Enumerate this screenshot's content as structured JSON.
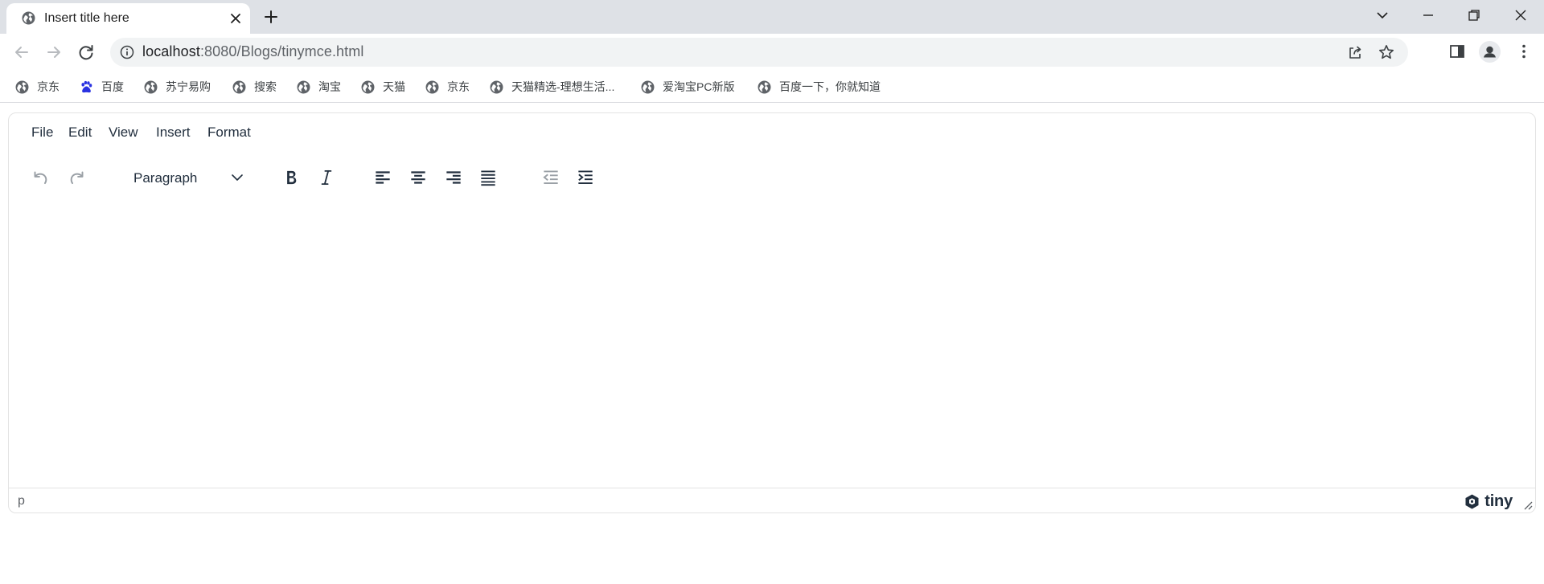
{
  "browser": {
    "tab_title": "Insert title here",
    "url_host": "localhost",
    "url_path": ":8080/Blogs/tinymce.html"
  },
  "bookmarks": [
    {
      "label": "京东",
      "icon": "globe-icon"
    },
    {
      "label": "百度",
      "icon": "baidu-paw-icon"
    },
    {
      "label": "苏宁易购",
      "icon": "globe-icon"
    },
    {
      "label": "搜索",
      "icon": "globe-icon"
    },
    {
      "label": "淘宝",
      "icon": "globe-icon"
    },
    {
      "label": "天猫",
      "icon": "globe-icon"
    },
    {
      "label": "京东",
      "icon": "globe-icon"
    },
    {
      "label": "天猫精选-理想生活...",
      "icon": "globe-icon"
    },
    {
      "label": "爱淘宝PC新版",
      "icon": "globe-icon"
    },
    {
      "label": "百度一下，你就知道",
      "icon": "globe-icon"
    }
  ],
  "editor": {
    "menu": [
      "File",
      "Edit",
      "View",
      "Insert",
      "Format"
    ],
    "block_format": "Paragraph",
    "toolbar_icons": [
      "undo-icon",
      "redo-icon",
      "bold-icon",
      "italic-icon",
      "align-left-icon",
      "align-center-icon",
      "align-right-icon",
      "align-justify-icon",
      "outdent-icon",
      "indent-icon"
    ],
    "status_path": "p",
    "brand": "tiny"
  },
  "colors": {
    "tab_strip": "#dee1e6",
    "omnibox": "#f1f3f4",
    "editor_text": "#222f3e",
    "editor_border": "#e3e3e3"
  }
}
